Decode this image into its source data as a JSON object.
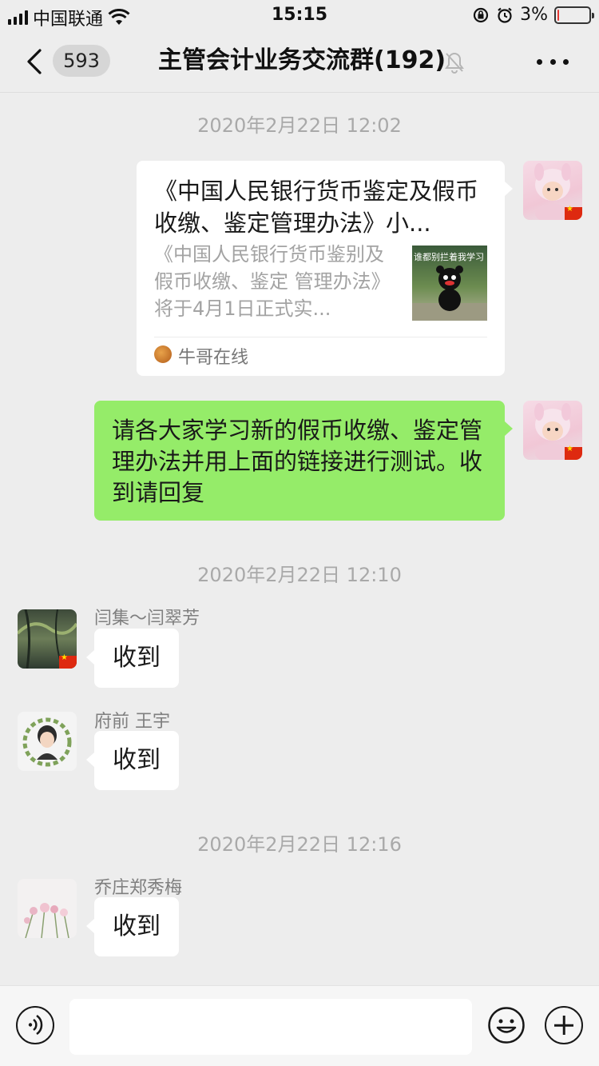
{
  "status_bar": {
    "carrier": "中国联通",
    "time": "15:15",
    "battery_percent": "3%",
    "battery_level": 0.03
  },
  "nav": {
    "unread_count": "593",
    "title": "主管会计业务交流群(192)",
    "back_icon": "chevron-left-icon",
    "mute_icon": "bell-muted-icon",
    "more_icon": "more-dots-icon"
  },
  "chat": {
    "timestamp_1": "2020年2月22日 12:02",
    "link_card": {
      "title": "《中国人民银行货币鉴定及假币收缴、鉴定管理办法》小...",
      "description": "《中国人民银行货币鉴别及假币收缴、鉴定 管理办法》将于4月1日正式实...",
      "thumbnail_text": "谁都别拦着我学习",
      "source": "牛哥在线"
    },
    "message_green": "请各大家学习新的假币收缴、鉴定管理办法并用上面的链接进行测试。收到请回复",
    "timestamp_2": "2020年2月22日 12:10",
    "message_1": {
      "sender": "闫集～闫翠芳",
      "text": "收到"
    },
    "message_2": {
      "sender": "府前  王宇",
      "text": "收到"
    },
    "timestamp_3": "2020年2月22日 12:16",
    "message_3": {
      "sender": "乔庄郑秀梅",
      "text": "收到"
    }
  },
  "input_bar": {
    "voice_icon": "voice-icon",
    "text_value": "",
    "emoji_icon": "emoji-icon",
    "plus_icon": "plus-icon"
  },
  "colors": {
    "background": "#ededed",
    "bubble_green": "#95ec69",
    "bubble_white": "#ffffff",
    "timestamp": "#a9a9a9"
  }
}
